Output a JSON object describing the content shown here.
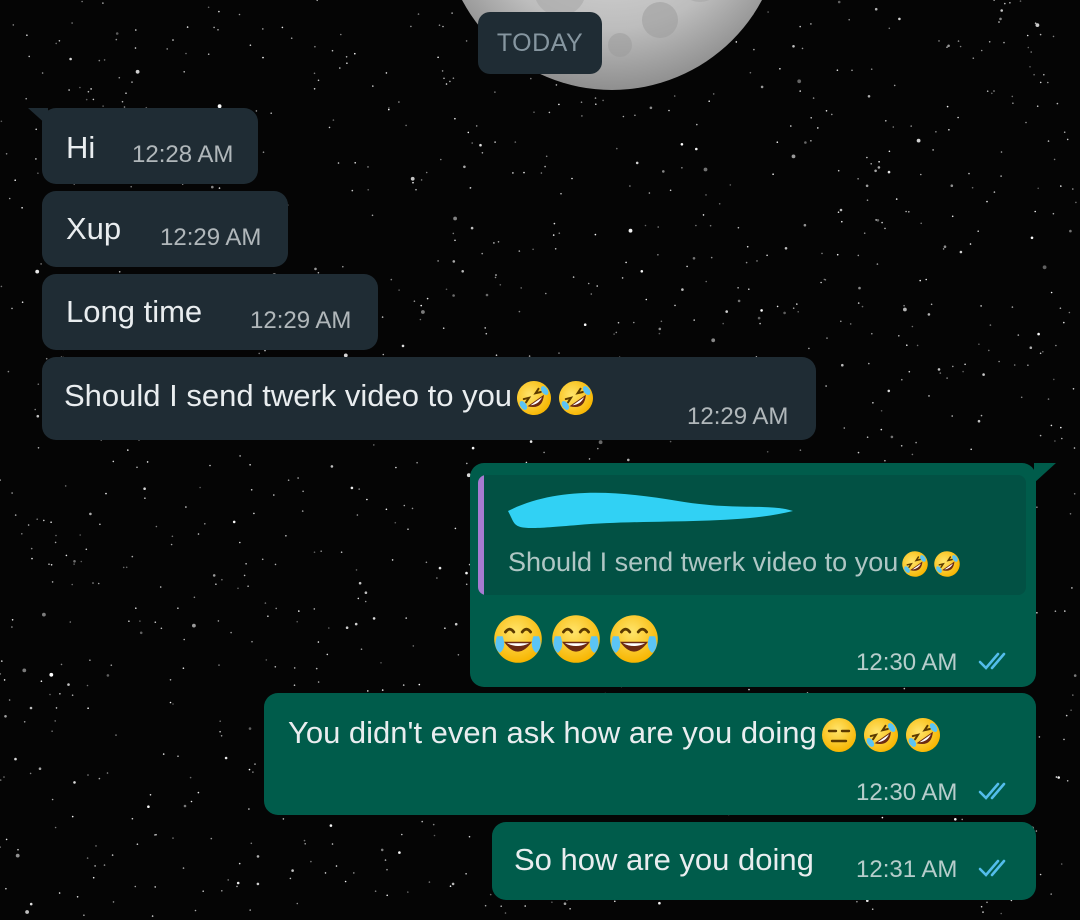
{
  "date_chip": "TODAY",
  "colors": {
    "incoming_bubble": "#1f2c34",
    "outgoing_bubble": "#005c4b",
    "quote_bar": "#a67bd1",
    "read_ticks": "#53bdeb",
    "redaction": "#31d1f4"
  },
  "messages": [
    {
      "direction": "incoming",
      "text": "Hi",
      "time": "12:28 AM"
    },
    {
      "direction": "incoming",
      "text": "Xup",
      "time": "12:29 AM"
    },
    {
      "direction": "incoming",
      "text": "Long time",
      "time": "12:29 AM"
    },
    {
      "direction": "incoming",
      "text": "Should I send twerk video to you",
      "emoji": [
        "rolling-on-floor-laughing",
        "rolling-on-floor-laughing"
      ],
      "time": "12:29 AM"
    },
    {
      "direction": "outgoing",
      "quote": {
        "author_redacted": true,
        "text": "Should I send twerk video to you",
        "emoji": [
          "rolling-on-floor-laughing",
          "rolling-on-floor-laughing"
        ]
      },
      "text": "",
      "emoji": [
        "face-with-tears-of-joy",
        "face-with-tears-of-joy",
        "face-with-tears-of-joy"
      ],
      "time": "12:30 AM",
      "status": "read"
    },
    {
      "direction": "outgoing",
      "text": "You didn't even ask how are you doing",
      "emoji": [
        "expressionless-face",
        "rolling-on-floor-laughing",
        "rolling-on-floor-laughing"
      ],
      "time": "12:30 AM",
      "status": "read"
    },
    {
      "direction": "outgoing",
      "text": "So how are you doing",
      "time": "12:31 AM",
      "status": "read"
    }
  ]
}
